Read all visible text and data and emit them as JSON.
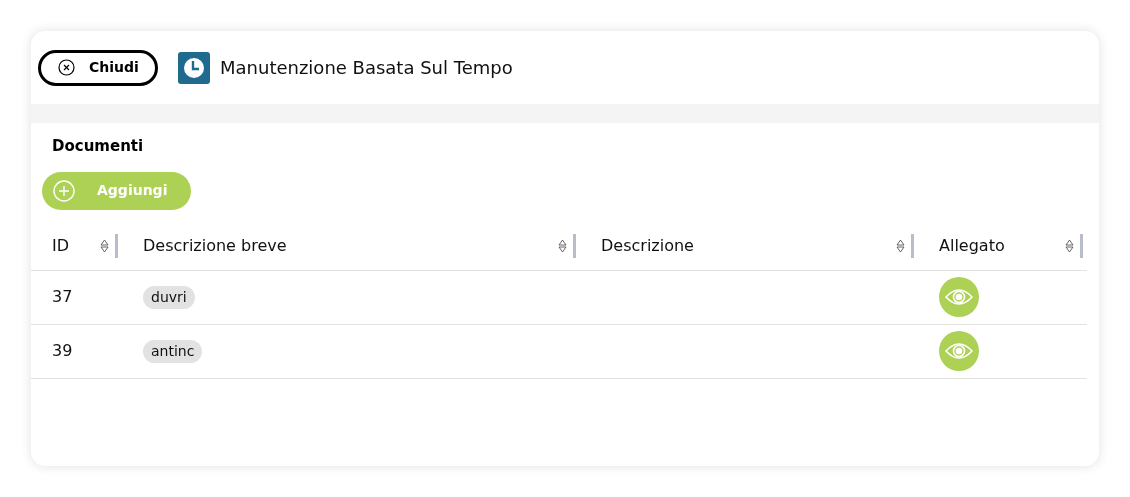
{
  "header": {
    "close_button": "Chiudi",
    "title": "Manutenzione Basata Sul Tempo"
  },
  "section": {
    "title": "Documenti",
    "add_button": "Aggiungi"
  },
  "table": {
    "columns": [
      "ID",
      "Descrizione breve",
      "Descrizione",
      "Allegato"
    ],
    "rows": [
      {
        "id": "37",
        "short_description": "duvri",
        "has_attachment": true
      },
      {
        "id": "39",
        "short_description": "antinc",
        "has_attachment": true
      }
    ]
  }
}
